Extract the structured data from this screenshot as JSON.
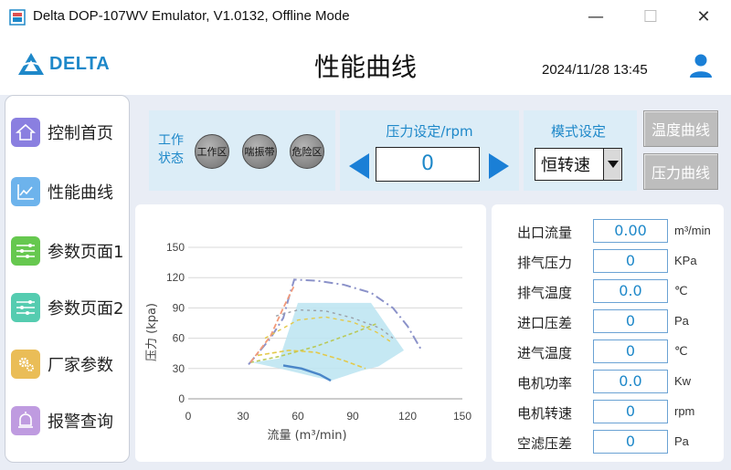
{
  "window": {
    "title": "Delta DOP-107WV Emulator, V1.0132, Offline Mode",
    "min_glyph": "—",
    "max_glyph": "☐",
    "close_glyph": "✕"
  },
  "header": {
    "logo_text": "DELTA",
    "page_title": "性能曲线",
    "date": "2024/11/28",
    "time": "13:45"
  },
  "sidebar": {
    "items": [
      {
        "label": "控制首页",
        "icon": "home-icon",
        "color": "#7b6fd6"
      },
      {
        "label": "性能曲线",
        "icon": "chart-line-icon",
        "color": "#5aa7e6"
      },
      {
        "label": "参数页面1",
        "icon": "list-icon",
        "color": "#5cc44a"
      },
      {
        "label": "参数页面2",
        "icon": "list-icon",
        "color": "#4cc9a6"
      },
      {
        "label": "厂家参数",
        "icon": "gear-icon",
        "color": "#e6b84d"
      },
      {
        "label": "报警查询",
        "icon": "alarm-bell-icon",
        "color": "#b28ad9"
      }
    ]
  },
  "status": {
    "label": "工作状态",
    "buttons": [
      "工作区",
      "喘振带",
      "危险区"
    ]
  },
  "speed": {
    "title": "压力设定/rpm",
    "value": "0"
  },
  "mode": {
    "title": "模式设定",
    "value": "恒转速"
  },
  "buttons": {
    "temp_curve": "温度曲线",
    "pressure_curve": "压力曲线"
  },
  "readouts": [
    {
      "label": "出口流量",
      "value": "0.00",
      "unit": "m³/min"
    },
    {
      "label": "排气压力",
      "value": "0",
      "unit": "KPa"
    },
    {
      "label": "排气温度",
      "value": "0.0",
      "unit": "℃"
    },
    {
      "label": "进口压差",
      "value": "0",
      "unit": "Pa"
    },
    {
      "label": "进气温度",
      "value": "0",
      "unit": "℃"
    },
    {
      "label": "电机功率",
      "value": "0.0",
      "unit": "Kw"
    },
    {
      "label": "电机转速",
      "value": "0",
      "unit": "rpm"
    },
    {
      "label": "空滤压差",
      "value": "0",
      "unit": "Pa"
    }
  ],
  "chart_data": {
    "type": "line",
    "xlabel": "流量 (m³/min)",
    "ylabel": "压力 (kpa)",
    "xlim": [
      0,
      150
    ],
    "ylim": [
      0,
      150
    ],
    "xticks": [
      0,
      30,
      60,
      90,
      120,
      150
    ],
    "yticks": [
      0,
      30,
      60,
      90,
      120,
      150
    ],
    "grid": "horizontal",
    "colors": {
      "region": "#bfe6f2",
      "top_curve": "#8b92c9",
      "mid_curve_1": "#e3c94a",
      "mid_curve_2": "#9aa0a8",
      "low_curve": "#b9c95a",
      "bottom_curve": "#4a86c8",
      "surge_line": "#f29a7a"
    },
    "series": [
      {
        "values": [
          [
            34,
            36
          ],
          [
            50,
            42
          ],
          [
            70,
            52
          ],
          [
            90,
            65
          ],
          [
            104,
            75
          ]
        ]
      },
      {
        "values": [
          [
            33,
            34
          ],
          [
            45,
            60
          ],
          [
            52,
            80
          ],
          [
            55,
            100
          ],
          [
            58,
            118
          ],
          [
            70,
            117
          ],
          [
            85,
            113
          ],
          [
            100,
            105
          ],
          [
            112,
            90
          ],
          [
            120,
            72
          ],
          [
            128,
            47
          ]
        ]
      },
      {
        "values": [
          [
            42,
            60
          ],
          [
            60,
            78
          ],
          [
            75,
            81
          ],
          [
            90,
            76
          ],
          [
            103,
            66
          ],
          [
            112,
            55
          ]
        ]
      },
      {
        "values": [
          [
            48,
            82
          ],
          [
            60,
            88
          ],
          [
            75,
            87
          ],
          [
            90,
            80
          ],
          [
            105,
            70
          ],
          [
            112,
            60
          ]
        ]
      },
      {
        "values": [
          [
            38,
            43
          ],
          [
            55,
            48
          ],
          [
            70,
            46
          ],
          [
            85,
            38
          ],
          [
            97,
            30
          ]
        ]
      },
      {
        "values": [
          [
            52,
            33
          ],
          [
            62,
            30
          ],
          [
            72,
            24
          ],
          [
            78,
            18
          ]
        ]
      }
    ],
    "region": [
      [
        35,
        36
      ],
      [
        50,
        40
      ],
      [
        60,
        95
      ],
      [
        100,
        95
      ],
      [
        118,
        48
      ],
      [
        104,
        32
      ],
      [
        95,
        28
      ],
      [
        78,
        18
      ],
      [
        50,
        30
      ]
    ]
  }
}
